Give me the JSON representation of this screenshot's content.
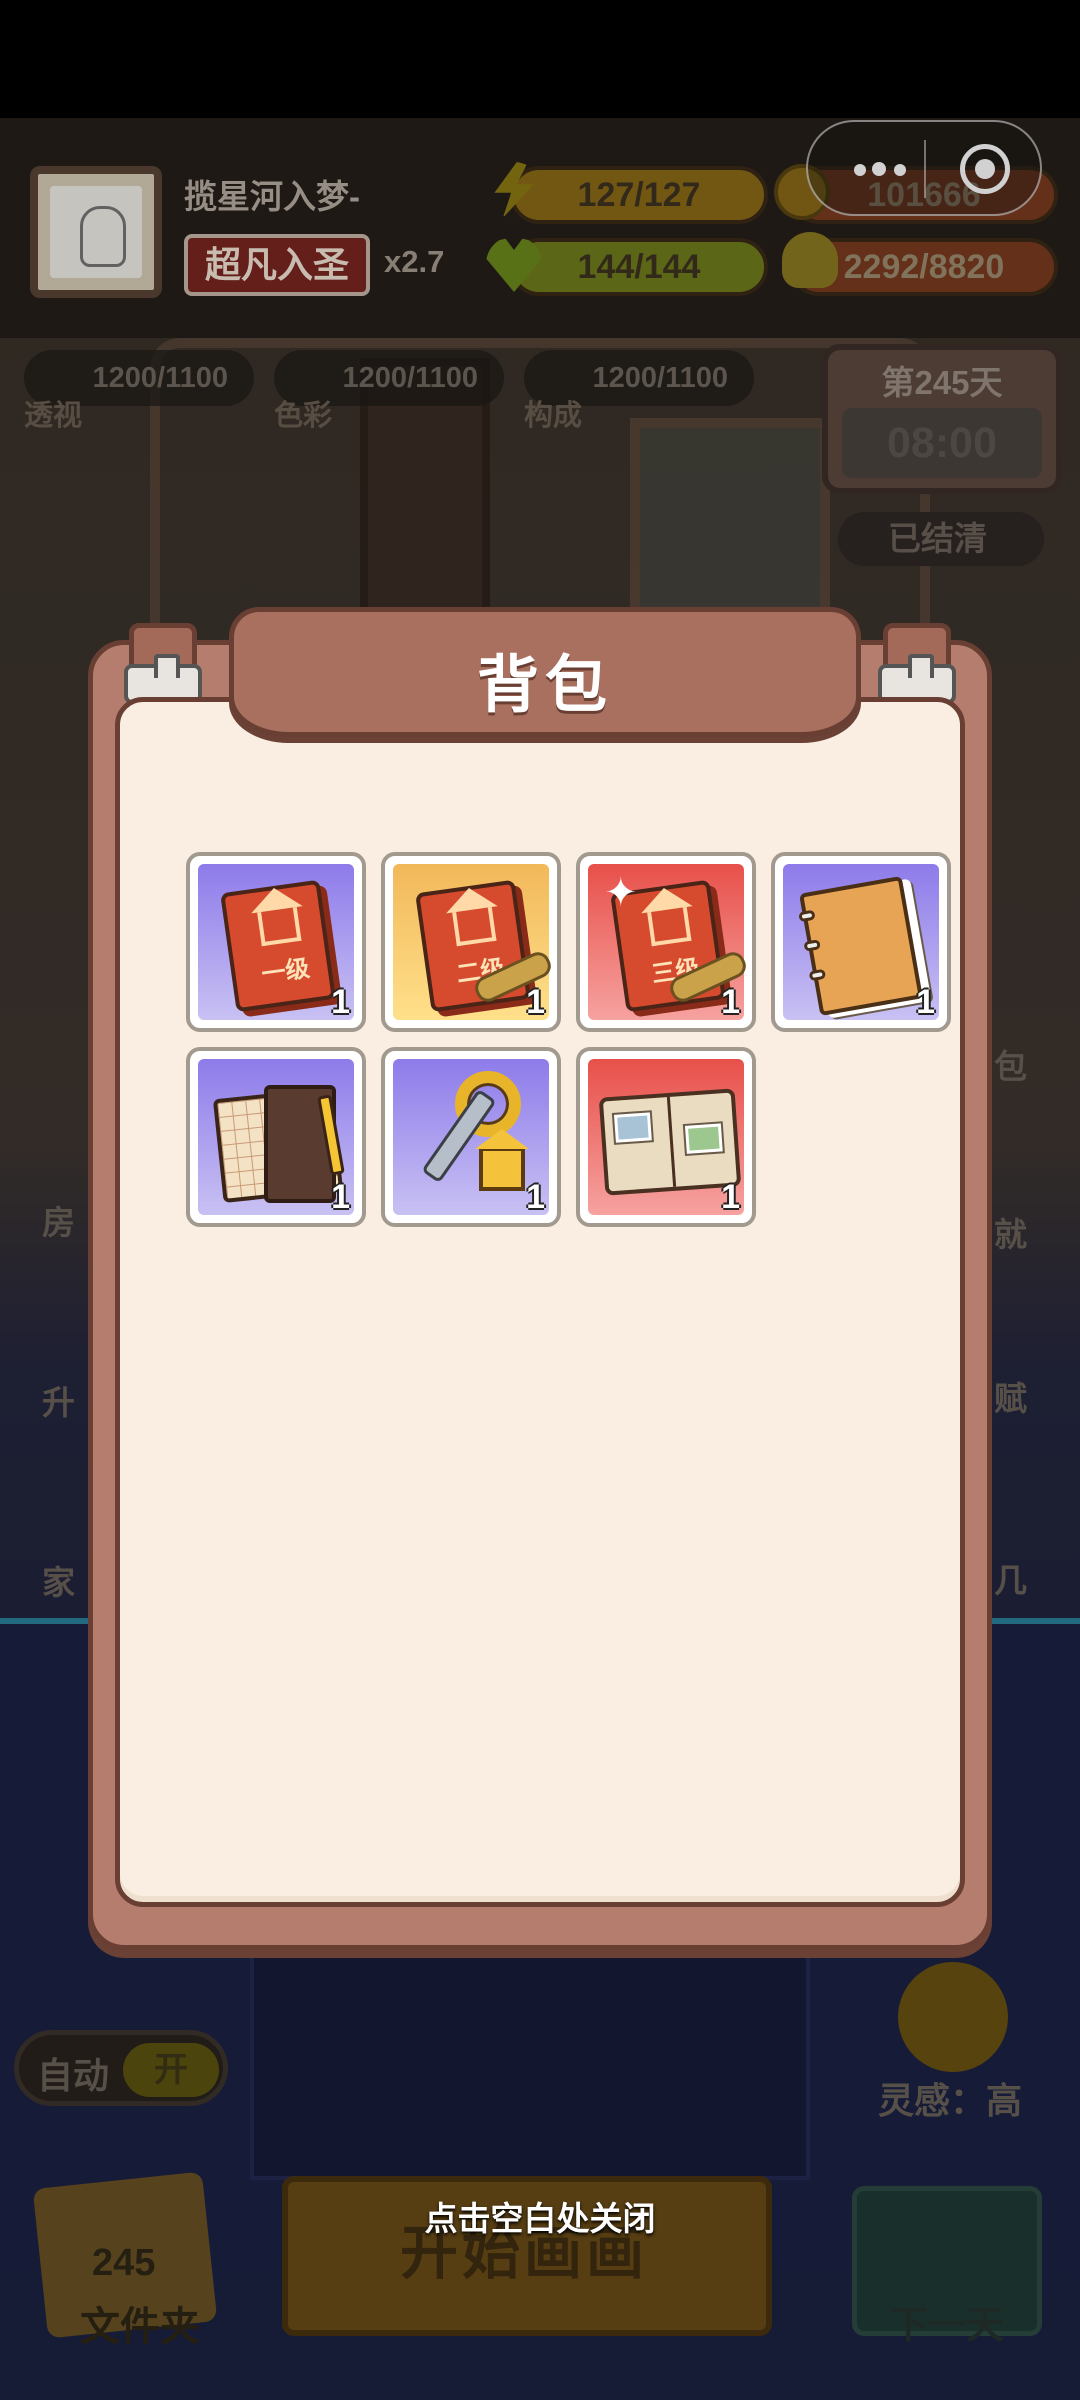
{
  "player": {
    "name": "揽星河入梦-",
    "rank": "超凡入圣",
    "multiplier": "x2.7"
  },
  "resources": {
    "energy": "127/127",
    "coins": "101666",
    "health": "144/144",
    "ideas": "2292/8820"
  },
  "skills": [
    {
      "value": "1200/1100",
      "label": "透视"
    },
    {
      "value": "1200/1100",
      "label": "色彩"
    },
    {
      "value": "1200/1100",
      "label": "构成"
    }
  ],
  "day": {
    "title": "第245天",
    "time": "08:00",
    "cleared_label": "已结清"
  },
  "side_labels": [
    "房",
    "升",
    "家",
    "包",
    "就",
    "赋",
    "几"
  ],
  "bottom": {
    "auto_label": "自动",
    "auto_state": "开",
    "folder_count": "245",
    "folder_label": "文件夹",
    "start_label": "开始画画",
    "inspiration": "灵感：高",
    "next_day": "下一天",
    "close_hint": "点击空白处关闭"
  },
  "backpack": {
    "title": "背包",
    "items": [
      {
        "name": "house-book-level-1",
        "label": "一级",
        "bg": "purple",
        "qty": "1"
      },
      {
        "name": "house-book-level-2",
        "label": "二级",
        "bg": "gold",
        "qty": "1"
      },
      {
        "name": "house-book-level-3",
        "label": "三级",
        "bg": "red",
        "qty": "1"
      },
      {
        "name": "notebook",
        "label": "",
        "bg": "purple",
        "qty": "1"
      },
      {
        "name": "planner",
        "label": "",
        "bg": "purple",
        "qty": "1"
      },
      {
        "name": "house-key",
        "label": "",
        "bg": "purple",
        "qty": "1"
      },
      {
        "name": "photo-album",
        "label": "",
        "bg": "red",
        "qty": "1"
      }
    ]
  },
  "colors": {
    "modal_frame": "#b57d6e",
    "modal_paper": "#f9eee1",
    "rank_badge": "#7b2620"
  }
}
